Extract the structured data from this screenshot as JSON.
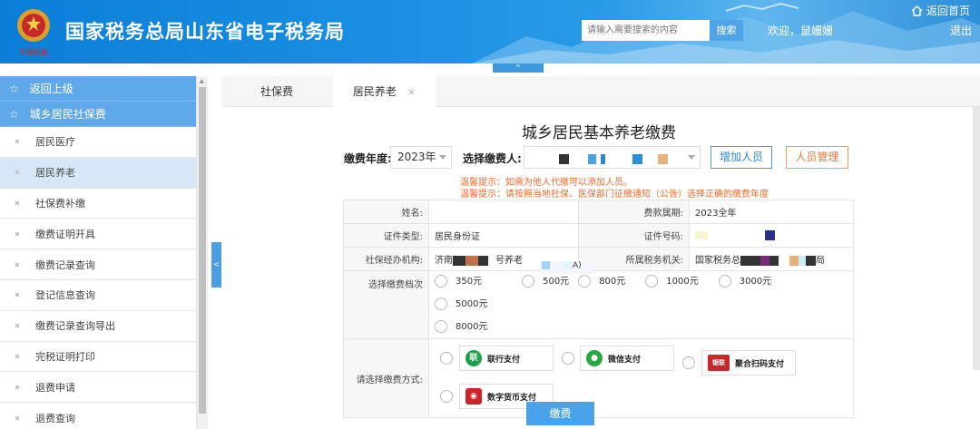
{
  "header": {
    "site_title": "国家税务总局山东省电子税务局",
    "search_placeholder": "请输入需要搜索的内容",
    "search_button": "搜索",
    "welcome": "欢迎，鼠姗姗",
    "home_link": "返回首页",
    "logout": "退出",
    "collapse_glyph": "^",
    "emblem_text": "中国税务"
  },
  "sidebar": {
    "back": "返回上级",
    "section": "城乡居民社保费",
    "items": [
      {
        "label": "居民医疗"
      },
      {
        "label": "居民养老"
      },
      {
        "label": "社保费补缴"
      },
      {
        "label": "缴费证明开具"
      },
      {
        "label": "缴费记录查询"
      },
      {
        "label": "登记信息查询"
      },
      {
        "label": "缴费记录查询导出"
      },
      {
        "label": "完税证明打印"
      },
      {
        "label": "退费申请"
      },
      {
        "label": "退费查询"
      }
    ],
    "active_index": 1,
    "toggle_glyph": "<"
  },
  "tabs": [
    {
      "label": "社保费",
      "active": false
    },
    {
      "label": "居民养老",
      "active": true,
      "close_glyph": "×"
    }
  ],
  "form": {
    "title": "城乡居民基本养老缴费",
    "year_label": "缴费年度:",
    "year_value": "2023年",
    "payer_label": "选择缴费人:",
    "add_button": "增加人员",
    "manage_button": "人员管理",
    "tip1": "温馨提示：如需为他人代缴可以添加人员。",
    "tip2": "温馨提示：请按照当地社保、医保部门征缴通知（公告）选择正确的缴费年度",
    "fields": {
      "name_label": "姓名:",
      "name_value": "",
      "period_label": "费款属期:",
      "period_value": "2023全年",
      "id_type_label": "证件类型:",
      "id_type_value": "居民身份证",
      "id_no_label": "证件号码:",
      "agency_label": "社保经办机构:",
      "agency_prefix": "济南",
      "agency_suffix": "号养老",
      "agency_tail": "A)",
      "tax_office_label": "所属税务机关:",
      "tax_office_prefix": "国家税务总",
      "tax_office_suffix": "局"
    },
    "tier_label": "选择缴费档次",
    "tiers": [
      "350元",
      "500元",
      "800元",
      "1000元",
      "3000元",
      "5000元",
      "8000元"
    ],
    "pay_method_label": "请选择缴费方式:",
    "pay_methods": [
      {
        "label": "联行支付",
        "icon": "unionpay-lian-icon",
        "glyph": "联"
      },
      {
        "label": "微信支付",
        "icon": "wechat-pay-icon",
        "glyph": "●"
      },
      {
        "label": "聚合扫码支付",
        "icon": "unionpay-card-icon",
        "glyph": "银联"
      },
      {
        "label": "数字货币支付",
        "icon": "digital-currency-icon",
        "glyph": "◉"
      }
    ],
    "submit": "缴费"
  },
  "colors": {
    "header_blue": "#0b7ed8",
    "accent_blue": "#4aa2ea",
    "tip_orange": "#f26a2a",
    "manage_orange": "#e8773b"
  }
}
